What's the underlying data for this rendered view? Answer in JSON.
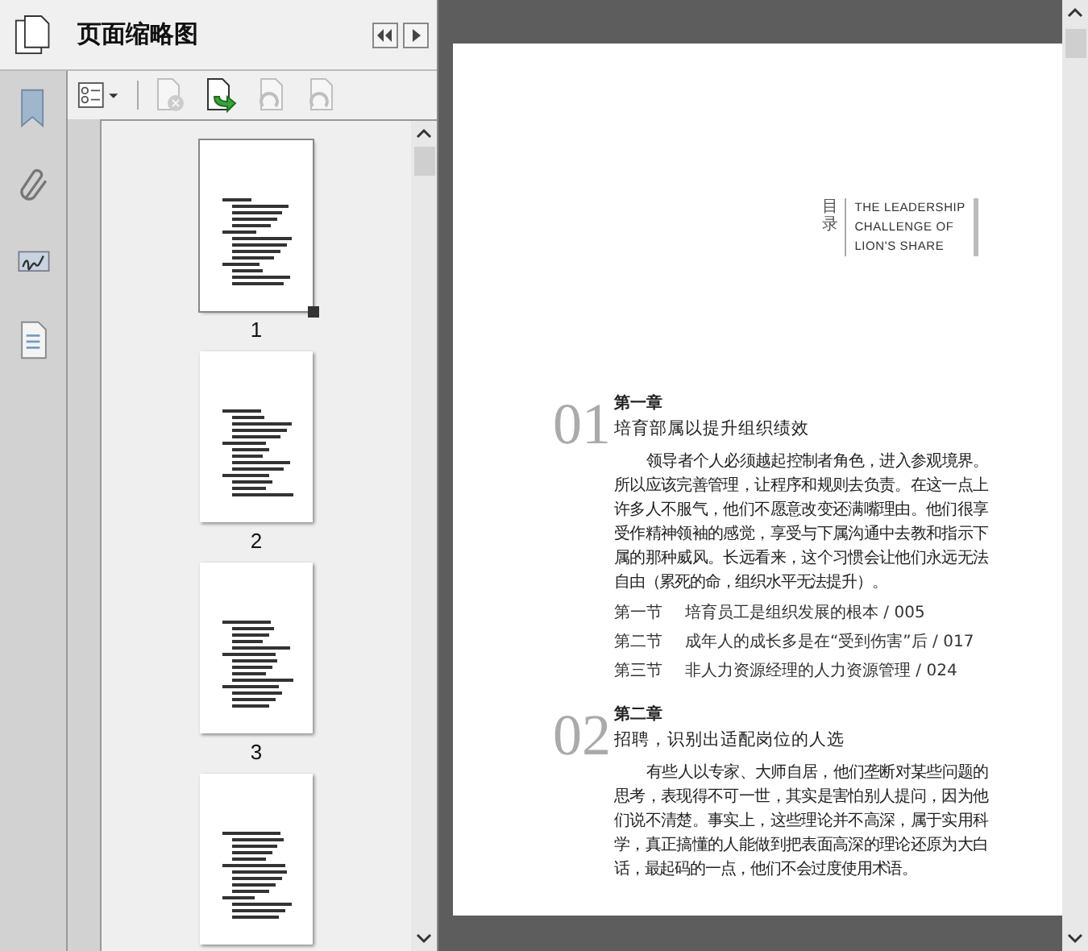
{
  "panel": {
    "title": "页面缩略图"
  },
  "toolbar": [
    {
      "kind": "options",
      "disabled": false
    },
    {
      "kind": "delete",
      "disabled": true
    },
    {
      "kind": "insert",
      "disabled": false
    },
    {
      "kind": "undo",
      "disabled": true
    },
    {
      "kind": "redo",
      "disabled": true
    }
  ],
  "thumbnails": [
    {
      "label": "1",
      "selected": true
    },
    {
      "label": "2",
      "selected": false
    },
    {
      "label": "3",
      "selected": false
    },
    {
      "selected": false
    }
  ],
  "document": {
    "header_mark": "目录",
    "header_lines": [
      "THE LEADERSHIP",
      "CHALLENGE OF",
      "LION'S SHARE"
    ],
    "chapters": [
      {
        "number": "01",
        "name": "第一章",
        "title": "培育部属以提升组织绩效",
        "paragraph": "领导者个人必须越起控制者角色，进入参观境界。所以应该完善管理，让程序和规则去负责。在这一点上许多人不服气，他们不愿意改变还满嘴理由。他们很享受作精神领袖的感觉，享受与下属沟通中去教和指示下属的那种威风。长远看来，这个习惯会让他们永远无法自由（累死的命，组织水平无法提升）。",
        "sections": [
          {
            "label": "第一节",
            "text": "培育员工是组织发展的根本 / 005"
          },
          {
            "label": "第二节",
            "text": "成年人的成长多是在“受到伤害”后 / 017"
          },
          {
            "label": "第三节",
            "text": "非人力资源经理的人力资源管理 / 024"
          }
        ]
      },
      {
        "number": "02",
        "name": "第二章",
        "title": "招聘，识别出适配岗位的人选",
        "paragraph": "有些人以专家、大师自居，他们垄断对某些问题的思考，表现得不可一世，其实是害怕别人提问，因为他们说不清楚。事实上，这些理论并不高深，属于实用科学，真正搞懂的人能做到把表面高深的理论还原为大白话，最起码的一点，他们不会过度使用术语。"
      }
    ]
  }
}
